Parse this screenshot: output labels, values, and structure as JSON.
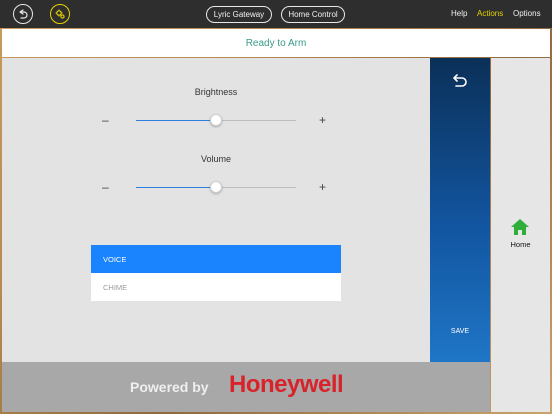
{
  "topbar": {
    "back_icon": "back-arrow-icon",
    "settings_icon": "gear-settings-icon",
    "lyric_gateway": "Lyric Gateway",
    "home_control": "Home Control",
    "help": "Help",
    "actions": "Actions",
    "options": "Options"
  },
  "status": {
    "text": "Ready to Arm"
  },
  "sliders": {
    "brightness": {
      "label": "Brightness",
      "minus": "–",
      "plus": "+",
      "level": 0.5
    },
    "volume": {
      "label": "Volume",
      "minus": "–",
      "plus": "+",
      "level": 0.5
    }
  },
  "sound_options": {
    "voice": "VOICE",
    "chime": "CHIME",
    "selected": "VOICE"
  },
  "sidebar": {
    "undo_icon": "undo-arrow-icon",
    "save": "SAVE"
  },
  "right": {
    "home_label": "Home",
    "home_icon": "home-icon"
  },
  "footer": {
    "powered": "Powered by",
    "brand": "Honeywell"
  },
  "colors": {
    "accent": "#1a84ff",
    "status_text": "#3a9a8a",
    "brand": "#d8232a",
    "active_menu": "#e6d200",
    "home_green": "#2fae3c"
  }
}
